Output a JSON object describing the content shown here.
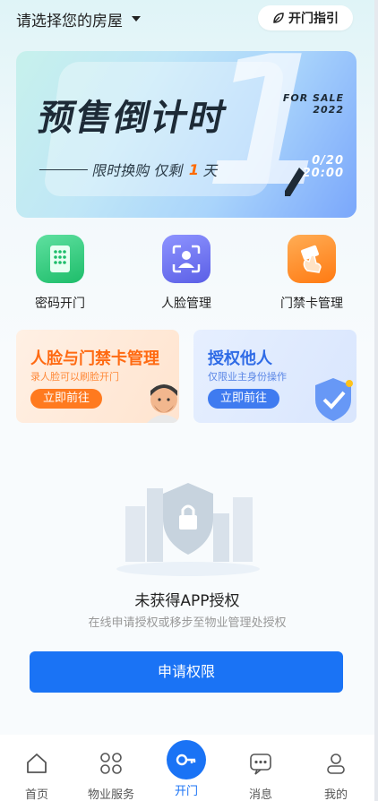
{
  "header": {
    "house_select_label": "请选择您的房屋",
    "guide_label": "开门指引"
  },
  "banner": {
    "title": "预售倒计时",
    "subtitle_prefix": "限时换购 仅剩",
    "subtitle_highlight": "1",
    "subtitle_suffix": "天",
    "big_number": "1",
    "for_sale": "FOR SALE",
    "year": "2022",
    "date_line1": "0/20",
    "date_line2": "20:00",
    "colors": {
      "highlight": "#ff6a00"
    }
  },
  "quick_actions": [
    {
      "label": "密码开门",
      "icon": "keypad-icon",
      "color": "#2fc97a"
    },
    {
      "label": "人脸管理",
      "icon": "face-id-icon",
      "color": "#6b73f2"
    },
    {
      "label": "门禁卡管理",
      "icon": "card-tap-icon",
      "color": "#ff8a1f"
    }
  ],
  "promo_cards": [
    {
      "title": "人脸与门禁卡管理",
      "desc": "录人脸可以刷脸开门",
      "button": "立即前往",
      "accent": "#ff7a1f"
    },
    {
      "title": "授权他人",
      "desc": "仅限业主身份操作",
      "button": "立即前往",
      "accent": "#3f7bf0"
    }
  ],
  "empty_state": {
    "title": "未获得APP授权",
    "subtitle": "在线申请授权或移步至物业管理处授权",
    "button": "申请权限"
  },
  "bottom_nav": [
    {
      "label": "首页",
      "icon": "home-icon"
    },
    {
      "label": "物业服务",
      "icon": "grid-icon"
    },
    {
      "label": "开门",
      "icon": "key-icon",
      "active": true
    },
    {
      "label": "消息",
      "icon": "message-icon"
    },
    {
      "label": "我的",
      "icon": "person-icon"
    }
  ]
}
